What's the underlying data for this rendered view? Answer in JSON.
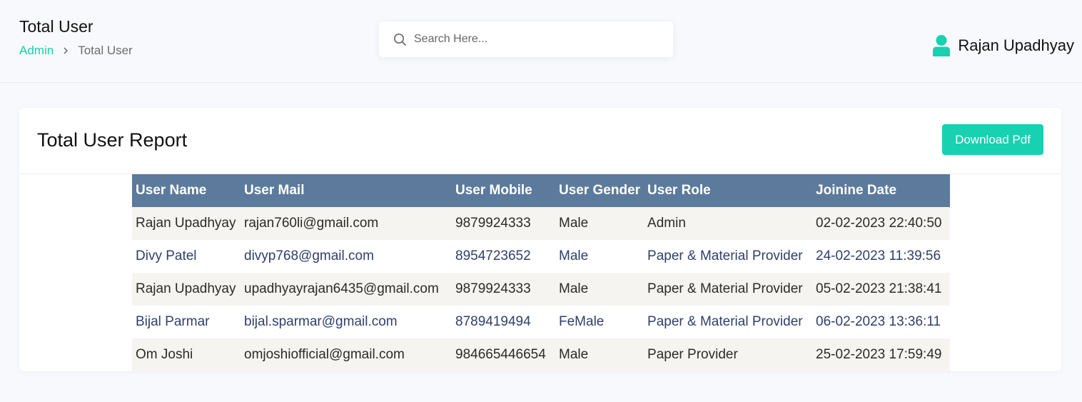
{
  "header": {
    "title": "Total User",
    "breadcrumb": {
      "parent": "Admin",
      "separator_icon": "chevron-right-icon",
      "current": "Total User"
    },
    "search": {
      "placeholder": "Search Here...",
      "value": "",
      "icon": "search-icon"
    },
    "user": {
      "icon": "user-icon",
      "name": "Rajan Upadhyay"
    }
  },
  "report": {
    "title": "Total User Report",
    "download_label": "Download Pdf",
    "columns": [
      "User Name",
      "User Mail",
      "User Mobile",
      "User Gender",
      "User Role",
      "Joinine Date"
    ],
    "rows": [
      [
        "Rajan Upadhyay",
        "rajan760li@gmail.com",
        "9879924333",
        "Male",
        "Admin",
        "02-02-2023 22:40:50"
      ],
      [
        "Divy Patel",
        "divyp768@gmail.com",
        "8954723652",
        "Male",
        "Paper & Material Provider",
        "24-02-2023 11:39:56"
      ],
      [
        "Rajan Upadhyay",
        "upadhyayrajan6435@gmail.com",
        "9879924333",
        "Male",
        "Paper & Material Provider",
        "05-02-2023 21:38:41"
      ],
      [
        "Bijal Parmar",
        "bijal.sparmar@gmail.com",
        "8789419494",
        "FeMale",
        "Paper & Material Provider",
        "06-02-2023 13:36:11"
      ],
      [
        "Om Joshi",
        "omjoshiofficial@gmail.com",
        "984665446654",
        "Male",
        "Paper Provider",
        "25-02-2023 17:59:49"
      ]
    ]
  },
  "colors": {
    "accent": "#17d1b0",
    "table_header": "#5c7a9c",
    "row_striped": "#f5f4f0"
  }
}
